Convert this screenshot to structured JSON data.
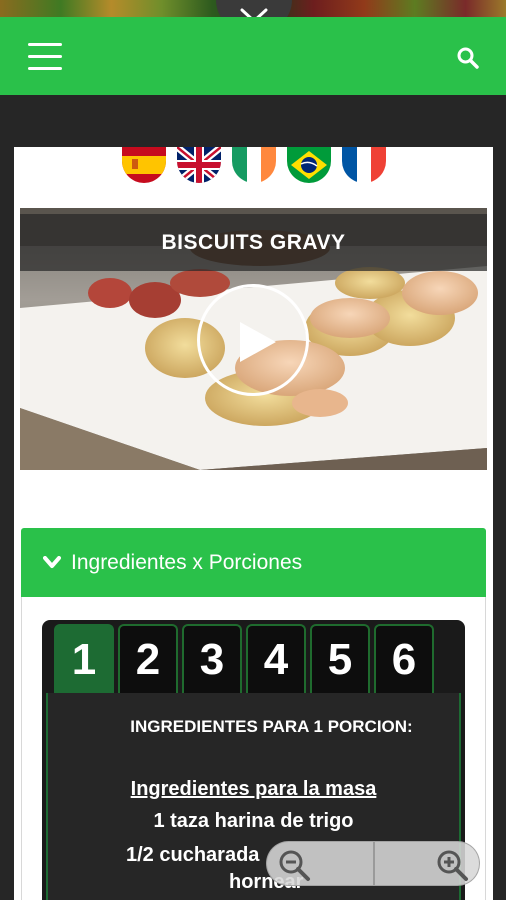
{
  "header": {
    "menu_icon": "hamburger-menu-icon",
    "search_icon": "search-icon",
    "pull_icon": "chevron-down-icon",
    "brand_color": "#2ac14a"
  },
  "languages": [
    {
      "name": "spanish-flag-icon"
    },
    {
      "name": "uk-flag-icon"
    },
    {
      "name": "ireland-flag-icon"
    },
    {
      "name": "brazil-flag-icon"
    },
    {
      "name": "france-flag-icon"
    }
  ],
  "video": {
    "title": "BISCUITS GRAVY",
    "play_icon": "play-icon"
  },
  "ingredients": {
    "header_label": "Ingredientes x Porciones",
    "chevron_icon": "chevron-down-icon",
    "tabs": [
      "1",
      "2",
      "3",
      "4",
      "5",
      "6"
    ],
    "active_tab": "1",
    "panel_title": "INGREDIENTES PARA 1 PORCION:",
    "section_title": "Ingredientes para la masa",
    "line1": "1 taza harina de trigo",
    "line2": "1/2 cucharada",
    "line3": "hornear"
  },
  "zoom": {
    "out_icon": "zoom-out-icon",
    "in_icon": "zoom-in-icon"
  }
}
